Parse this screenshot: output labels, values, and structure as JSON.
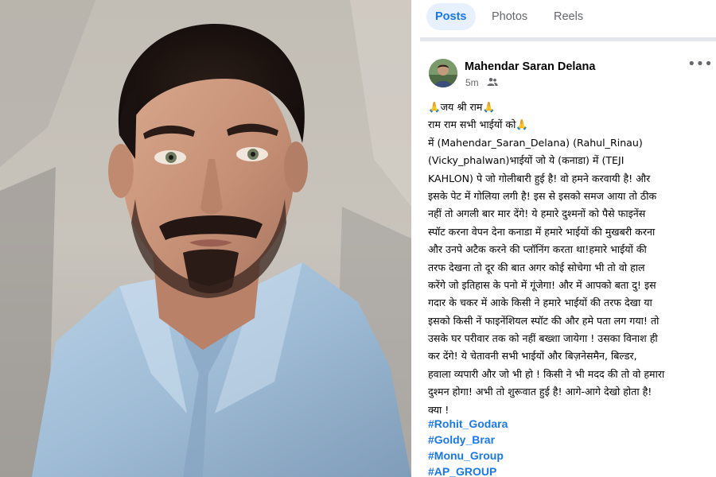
{
  "tabs": [
    "Posts",
    "Photos",
    "Reels"
  ],
  "post": {
    "author": "Mahendar Saran Delana",
    "time": "5m",
    "audience_icon": "friends-icon",
    "more_icon": "more-options-icon",
    "more_label": "•••",
    "lines": [
      "🙏जय श्री राम🙏",
      "राम राम सभी भाईयों को🙏",
      "में (Mahendar_Saran_Delana) (Rahul_Rinau)",
      "(Vicky_phalwan)भाईयों  जो ये (कनाडा) में (TEJI",
      "KAHLON) पे जो गोलीबारी हुई है! वो हमने करवायी है! और",
      "इसके पेट में गोलिया लगी है! इस से इसको समज आया तो ठीक",
      "नहीं तो अगली बार मार देंगे! ये हमारे दुश्मनों को पैसे फाइनेंस",
      "स्पॉट करना वेपन देना कनाडा में हमारे भाईयों की मुखबरी करना",
      "और उनपे अटैक करने की प्लॉनिंग करता था!हमारे भाईयों की",
      "तरफ देखना तो दूर की बात अगर कोई सोचेगा भी तो वो हाल",
      "करेंगे जो इतिहास के पनो में गूंजेगा! और में आपको बता दु! इस",
      "गदार के चकर में आके किसी ने हमारे भाईयों की तरफ  देखा या",
      "इसको किसी नें फाइनेंशियल स्पॉट की और हमे पता लग गया! तो",
      "उसके घर परीवार तक को नहीं बख्शा जायेगा ! उसका विनाश ही",
      "कर देंगे! ये चेतावनी सभी भाईयों और बिज़नेसमैन, बिल्डर,",
      "हवाला व्यपारी और जो भी हो ! किसी ने भी मदद की तो वो हमारा",
      "दुश्मन होगा! अभी तो शुरूवात हुई है! आगे-आगे देखो होता है!",
      "क्या !"
    ],
    "hashtags": [
      "#Rohit_Godara",
      "#Goldy_Brar",
      "#Monu_Group",
      "#AP_GROUP"
    ]
  },
  "colors": {
    "accent": "#1877f2",
    "tab_active_bg": "#e7f0fd",
    "muted_text": "#65676b",
    "body_text": "#050505"
  }
}
